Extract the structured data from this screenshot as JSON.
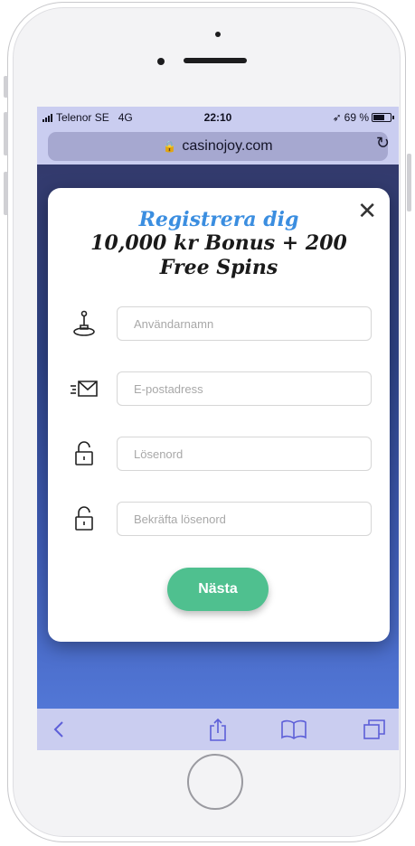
{
  "status_bar": {
    "carrier": "Telenor SE",
    "network": "4G",
    "time": "22:10",
    "battery": "69 %",
    "battery_level": 0.69
  },
  "browser": {
    "url": "casinojoy.com"
  },
  "modal": {
    "heading": "Registrera dig",
    "bonus_text": "10,000 kr Bonus + 200 Free Spins",
    "fields": {
      "username_placeholder": "Användarnamn",
      "email_placeholder": "E-postadress",
      "password_placeholder": "Lösenord",
      "confirm_password_placeholder": "Bekräfta lösenord"
    },
    "next_button": "Nästa"
  },
  "toolbar_icons": [
    "back-icon",
    "share-icon",
    "bookmarks-icon",
    "tabs-icon"
  ],
  "colors": {
    "accent_blue": "#3b8ee0",
    "button_green": "#4fc08f",
    "browser_chrome": "#cacdf0",
    "icon_blue": "#5d5fd8"
  }
}
